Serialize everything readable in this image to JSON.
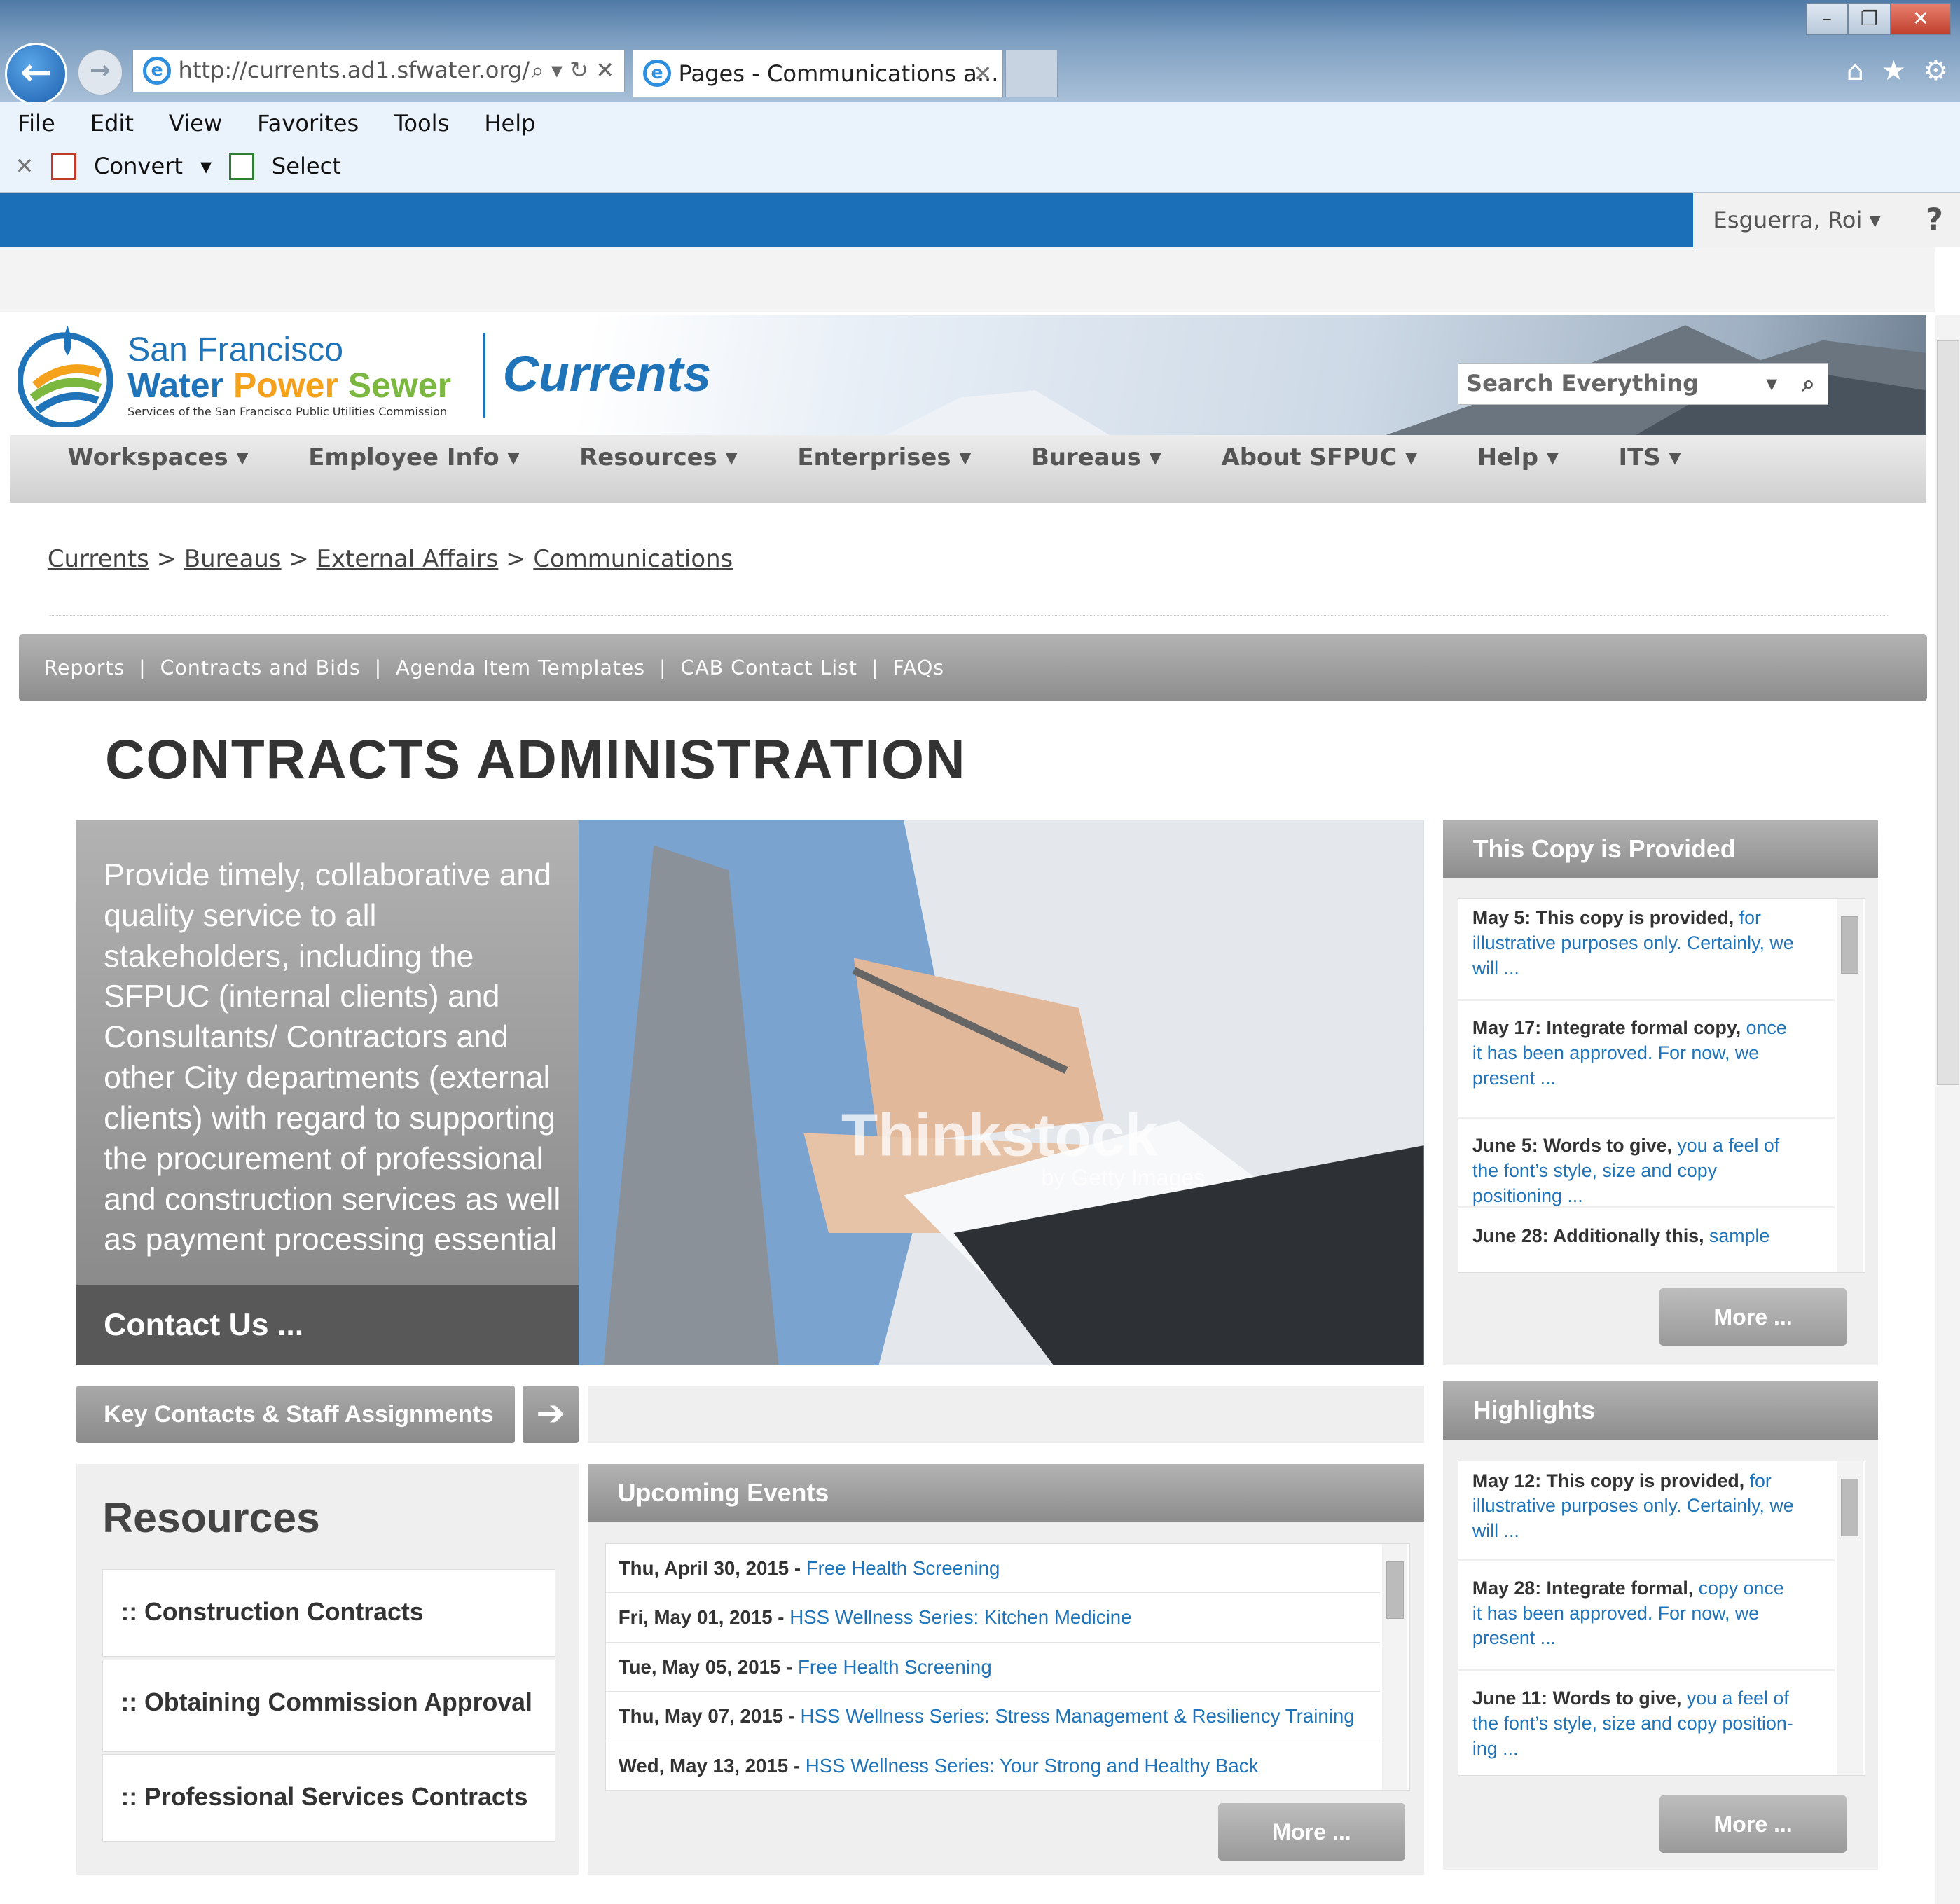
{
  "browser": {
    "url": "http://currents.ad1.sfwater.org/",
    "tab_title": "Pages - Communications a...",
    "menu": [
      "File",
      "Edit",
      "View",
      "Favorites",
      "Tools",
      "Help"
    ],
    "cmd_convert": "Convert",
    "cmd_select": "Select"
  },
  "user": {
    "name": "Esguerra, Roi",
    "help": "?"
  },
  "brand": {
    "line1": "San Francisco",
    "line2_water": "Water",
    "line2_power": "Power",
    "line2_sewer": "Sewer",
    "sub": "Services of the San Francisco Public Utilities Commission",
    "site_name": "Currents"
  },
  "search": {
    "placeholder": "Search Everything"
  },
  "nav": [
    "Workspaces",
    "Employee Info",
    "Resources",
    "Enterprises",
    "Bureaus",
    "About SFPUC",
    "Help",
    "ITS"
  ],
  "breadcrumb": [
    "Currents",
    "Bureaus",
    "External Affairs",
    "Communications"
  ],
  "subnav": [
    "Reports",
    "Contracts and Bids",
    "Agenda Item Templates",
    "CAB Contact List",
    "FAQs"
  ],
  "page_title": "CONTRACTS ADMINISTRATION",
  "hero": {
    "text": "Provide timely, collaborative and quality service to all stakeholders, including the SFPUC (internal clients) and Consultants/ Contractors and other City departments (external clients) with regard to supporting the procurement of professional and construction services as well as payment processing essential ...",
    "contact": "Contact Us ...",
    "watermark": "Thinkstock",
    "watermark_sub": "by Getty Images"
  },
  "key_contacts": "Key Contacts & Staff Assignments",
  "resources": {
    "title": "Resources",
    "items": [
      ":: Construction Contracts",
      ":: Obtaining Commission Approval",
      ":: Professional Services Contracts"
    ]
  },
  "events": {
    "title": "Upcoming Events",
    "rows": [
      {
        "date": "Thu, April 30, 2015 - ",
        "title": "Free Health Screening"
      },
      {
        "date": "Fri, May 01, 2015 - ",
        "title": "HSS Wellness Series: Kitchen Medicine"
      },
      {
        "date": "Tue, May 05, 2015 - ",
        "title": "Free Health Screening"
      },
      {
        "date": "Thu, May 07, 2015 - ",
        "title": "HSS Wellness Series: Stress Management & Resiliency Training"
      },
      {
        "date": "Wed, May 13, 2015 - ",
        "title": "HSS Wellness Series: Your Strong and Healthy Back"
      }
    ],
    "more": "More ..."
  },
  "copy_panel": {
    "title": "This Copy is Provided",
    "rows": [
      {
        "lead": "May 5:  This copy is provided, ",
        "rest": "for illustrative purposes only. Certainly, we will ..."
      },
      {
        "lead": "May 17:  Integrate formal copy, ",
        "rest": "once it has been approved. For now, we present ..."
      },
      {
        "lead": "June 5:  Words to give, ",
        "rest": "you a feel of the font’s style, size and copy positioning ..."
      },
      {
        "lead": "June 28:  Additionally this, ",
        "rest": "sample"
      }
    ],
    "more": "More ..."
  },
  "highlights": {
    "title": "Highlights",
    "rows": [
      {
        "lead": "May 12:  This copy is provided, ",
        "rest": "for illustrative purposes only. Certainly, we will ..."
      },
      {
        "lead": "May 28:  Integrate formal, ",
        "rest": "copy once it has been approved. For now, we present ..."
      },
      {
        "lead": "June 11:  Words to give, ",
        "rest": "you a feel of the font’s style, size and copy position-ing ..."
      }
    ],
    "more": "More ..."
  },
  "colors": {
    "brand_blue": "#1e73b9",
    "bar_blue": "#1a6fb8",
    "panel_gray": "#8d8d8d",
    "power_orange": "#f5a11b",
    "sewer_green": "#7cb83f"
  }
}
